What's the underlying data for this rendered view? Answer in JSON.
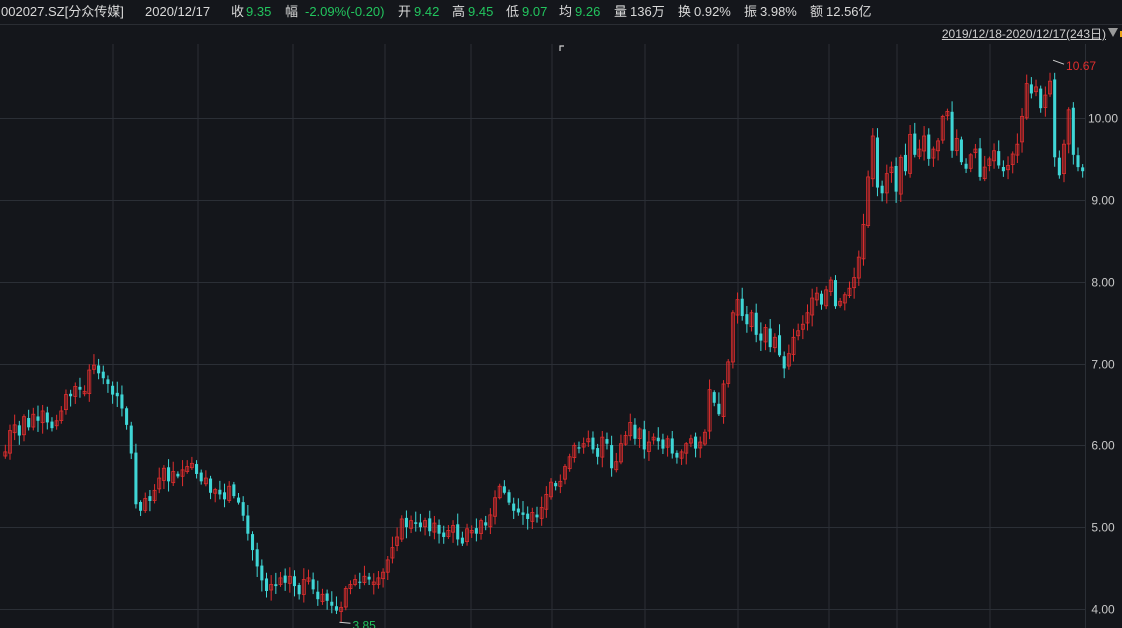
{
  "header": {
    "code": "002027.SZ[分众传媒]",
    "date": "2020/12/17",
    "close_label": "收",
    "close_value": "9.35",
    "change_label": "幅",
    "change_value": "-2.09%(-0.20)",
    "open_label": "开",
    "open_value": "9.42",
    "high_label": "高",
    "high_value": "9.45",
    "low_label": "低",
    "low_value": "9.07",
    "avg_label": "均",
    "avg_value": "9.26",
    "volume_label": "量",
    "volume_value": "136万",
    "turnover_label": "换",
    "turnover_value": "0.92%",
    "amplitude_label": "振",
    "amplitude_value": "3.98%",
    "amount_label": "额",
    "amount_value": "12.56亿"
  },
  "range": {
    "label": "2019/12/18-2020/12/17(243日)",
    "dropdown_icon": "triangle-down-icon"
  },
  "colors": {
    "background": "#14161b",
    "grid": "#2b2f36",
    "up": "#e02e2e",
    "down": "#3fd6d6",
    "axis_text": "#c8c8c8",
    "high_marker": "#e02e2e",
    "low_marker": "#22c55e"
  },
  "chart_data": {
    "type": "candlestick",
    "title": "",
    "xlabel": "",
    "ylabel": "",
    "ylim": [
      3.85,
      10.75
    ],
    "y_ticks": [
      "4.00",
      "5.00",
      "6.00",
      "7.00",
      "8.00",
      "9.00",
      "10.00"
    ],
    "grid": true,
    "max_marker": "10.67",
    "min_marker": "3.85",
    "series": [
      {
        "name": "",
        "close": [
          5.92,
          6.18,
          6.25,
          6.12,
          6.35,
          6.22,
          6.38,
          6.3,
          6.42,
          6.28,
          6.21,
          6.3,
          6.42,
          6.62,
          6.6,
          6.72,
          6.68,
          6.66,
          6.92,
          6.98,
          6.88,
          6.82,
          6.75,
          6.62,
          6.6,
          6.45,
          6.25,
          5.9,
          5.28,
          5.2,
          5.35,
          5.32,
          5.45,
          5.6,
          5.72,
          5.56,
          5.68,
          5.62,
          5.7,
          5.74,
          5.78,
          5.65,
          5.56,
          5.6,
          5.42,
          5.46,
          5.4,
          5.34,
          5.5,
          5.38,
          5.3,
          5.14,
          4.92,
          4.72,
          4.52,
          4.35,
          4.22,
          4.3,
          4.28,
          4.38,
          4.32,
          4.4,
          4.28,
          4.18,
          4.36,
          4.38,
          4.24,
          4.12,
          4.18,
          4.1,
          4.04,
          3.98,
          4.02,
          4.25,
          4.3,
          4.36,
          4.32,
          4.4,
          4.36,
          4.33,
          4.38,
          4.45,
          4.6,
          4.75,
          4.88,
          5.1,
          5.0,
          5.08,
          5.04,
          5.0,
          5.08,
          4.95,
          5.05,
          4.92,
          4.88,
          4.96,
          5.02,
          4.85,
          4.8,
          4.98,
          4.96,
          4.92,
          5.08,
          5.02,
          5.15,
          5.36,
          5.5,
          5.42,
          5.3,
          5.2,
          5.18,
          5.15,
          5.1,
          5.18,
          5.12,
          5.24,
          5.4,
          5.55,
          5.5,
          5.56,
          5.74,
          5.86,
          6.0,
          5.96,
          6.02,
          6.08,
          5.95,
          5.86,
          6.1,
          6.02,
          5.72,
          5.8,
          6.02,
          6.12,
          6.28,
          6.08,
          6.2,
          5.95,
          6.04,
          6.1,
          6.05,
          5.96,
          6.08,
          5.9,
          5.85,
          5.92,
          6.02,
          6.08,
          5.96,
          6.04,
          6.16,
          6.68,
          6.52,
          6.38,
          6.75,
          7.02,
          7.62,
          7.78,
          7.58,
          7.48,
          7.62,
          7.35,
          7.28,
          7.44,
          7.2,
          7.32,
          7.1,
          6.94,
          7.12,
          7.32,
          7.4,
          7.48,
          7.62,
          7.8,
          7.86,
          7.72,
          7.9,
          8.02,
          7.7,
          7.76,
          7.84,
          7.92,
          8.05,
          8.3,
          8.7,
          9.28,
          9.78,
          9.15,
          9.08,
          9.32,
          9.4,
          9.1,
          9.52,
          9.35,
          9.8,
          9.55,
          9.62,
          9.78,
          9.5,
          9.62,
          9.72,
          10.02,
          10.08,
          9.6,
          9.75,
          9.46,
          9.38,
          9.55,
          9.62,
          9.28,
          9.4,
          9.5,
          9.6,
          9.42,
          9.35,
          9.42,
          9.56,
          9.68,
          10.02,
          10.42,
          10.3,
          10.38,
          10.12,
          10.28,
          10.45,
          9.52,
          9.3,
          9.68,
          10.1,
          9.55,
          9.4,
          9.35
        ]
      }
    ]
  }
}
